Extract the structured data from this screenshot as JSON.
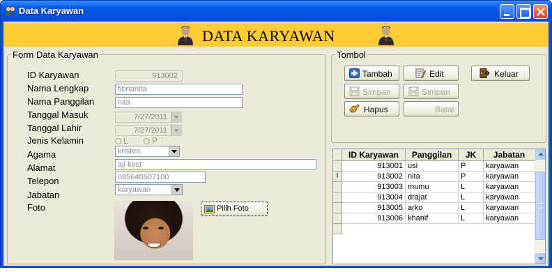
{
  "window": {
    "title": "Data Karyawan"
  },
  "header": {
    "title": "DATA KARYAWAN"
  },
  "form": {
    "legend": "Form Data Karyawan",
    "labels": {
      "id": "ID Karyawan",
      "nama_lengkap": "Nama Lengkap",
      "nama_panggilan": "Nama Panggilan",
      "tanggal_masuk": "Tanggal Masuk",
      "tanggal_lahir": "Tanggal Lahir",
      "jenis_kelamin": "Jenis Kelamin",
      "agama": "Agama",
      "alamat": "Alamat",
      "telepon": "Telepon",
      "jabatan": "Jabatan",
      "foto": "Foto"
    },
    "values": {
      "id": "913002",
      "nama_lengkap": "fibrianita",
      "nama_panggilan": "nita",
      "tanggal_masuk": "7/27/2011",
      "tanggal_lahir": "7/27/2011",
      "gender_l": "L",
      "gender_p": "P",
      "agama": "kristen",
      "alamat": "aji kost",
      "telepon": "085640507100",
      "jabatan": "karyawan"
    },
    "pilih_foto_label": "Pilih Foto"
  },
  "tombol": {
    "legend": "Tombol",
    "tambah": "Tambah",
    "edit": "Edit",
    "keluar": "Keluar",
    "simpan1": "Simpan",
    "simpan2": "Simpan",
    "hapus": "Hapus",
    "batal": "Batal"
  },
  "table": {
    "columns": [
      "ID Karyawan",
      "Panggilan",
      "JK",
      "Jabatan"
    ],
    "rows": [
      [
        "913001",
        "usi",
        "P",
        "karyawan"
      ],
      [
        "913002",
        "nita",
        "P",
        "karyawan"
      ],
      [
        "913003",
        "mumu",
        "L",
        "karyawan"
      ],
      [
        "913004",
        "drajat",
        "L",
        "karyawan"
      ],
      [
        "913005",
        "arko",
        "L",
        "karyawan"
      ],
      [
        "913006",
        "khanif",
        "L",
        "karyawan"
      ]
    ],
    "current_row_marker": "I"
  },
  "colors": {
    "title_bar": "#0a5ce8",
    "header_band": "#ffcc33",
    "face": "#ece9d8"
  },
  "icons": [
    "users-icon",
    "person-icon",
    "add-icon",
    "edit-icon",
    "exit-icon",
    "save-icon",
    "delete-icon",
    "photo-icon"
  ]
}
